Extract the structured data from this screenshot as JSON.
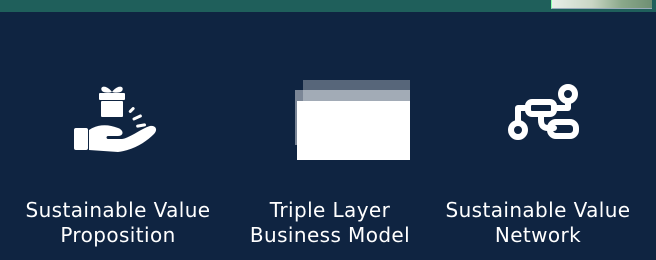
{
  "features": [
    {
      "line1": "Sustainable Value",
      "line2": "Proposition",
      "icon": "gift-in-hand-icon"
    },
    {
      "line1": "Triple Layer",
      "line2": "Business Model",
      "icon": "layered-canvas-icon"
    },
    {
      "line1": "Sustainable Value",
      "line2": "Network",
      "icon": "network-flow-icon"
    }
  ],
  "colors": {
    "background": "#0f2441",
    "topbar": "#1f5f5b",
    "text": "#ffffff"
  }
}
